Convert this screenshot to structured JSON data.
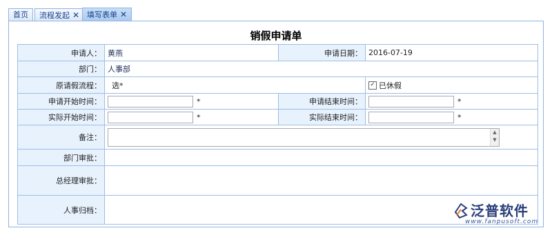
{
  "tabs": [
    {
      "label": "首页",
      "closable": false
    },
    {
      "label": "流程发起",
      "closable": true
    },
    {
      "label": "填写表单",
      "closable": true,
      "active": true
    }
  ],
  "close_glyph": "✕",
  "form": {
    "title": "销假申请单",
    "applicant_label": "申请人：",
    "applicant_value": "黄燕",
    "apply_date_label": "申请日期：",
    "apply_date_value": "2016-07-19",
    "dept_label": "部门：",
    "dept_value": "人事部",
    "orig_flow_label": "原请假流程：",
    "orig_flow_value": "选*",
    "rested_label": "已休假",
    "rested_checked": true,
    "apply_start_label": "申请开始时间：",
    "apply_end_label": "申请结束时间：",
    "actual_start_label": "实际开始时间：",
    "actual_end_label": "实际结束时间：",
    "required_mark": "*",
    "remark_label": "备注：",
    "dept_approve_label": "部门审批：",
    "gm_approve_label": "总经理审批：",
    "hr_archive_label": "人事归档："
  },
  "logo": {
    "name": "泛普软件",
    "url": "www.fanpusoft.com",
    "color": "#2a3f7a"
  }
}
